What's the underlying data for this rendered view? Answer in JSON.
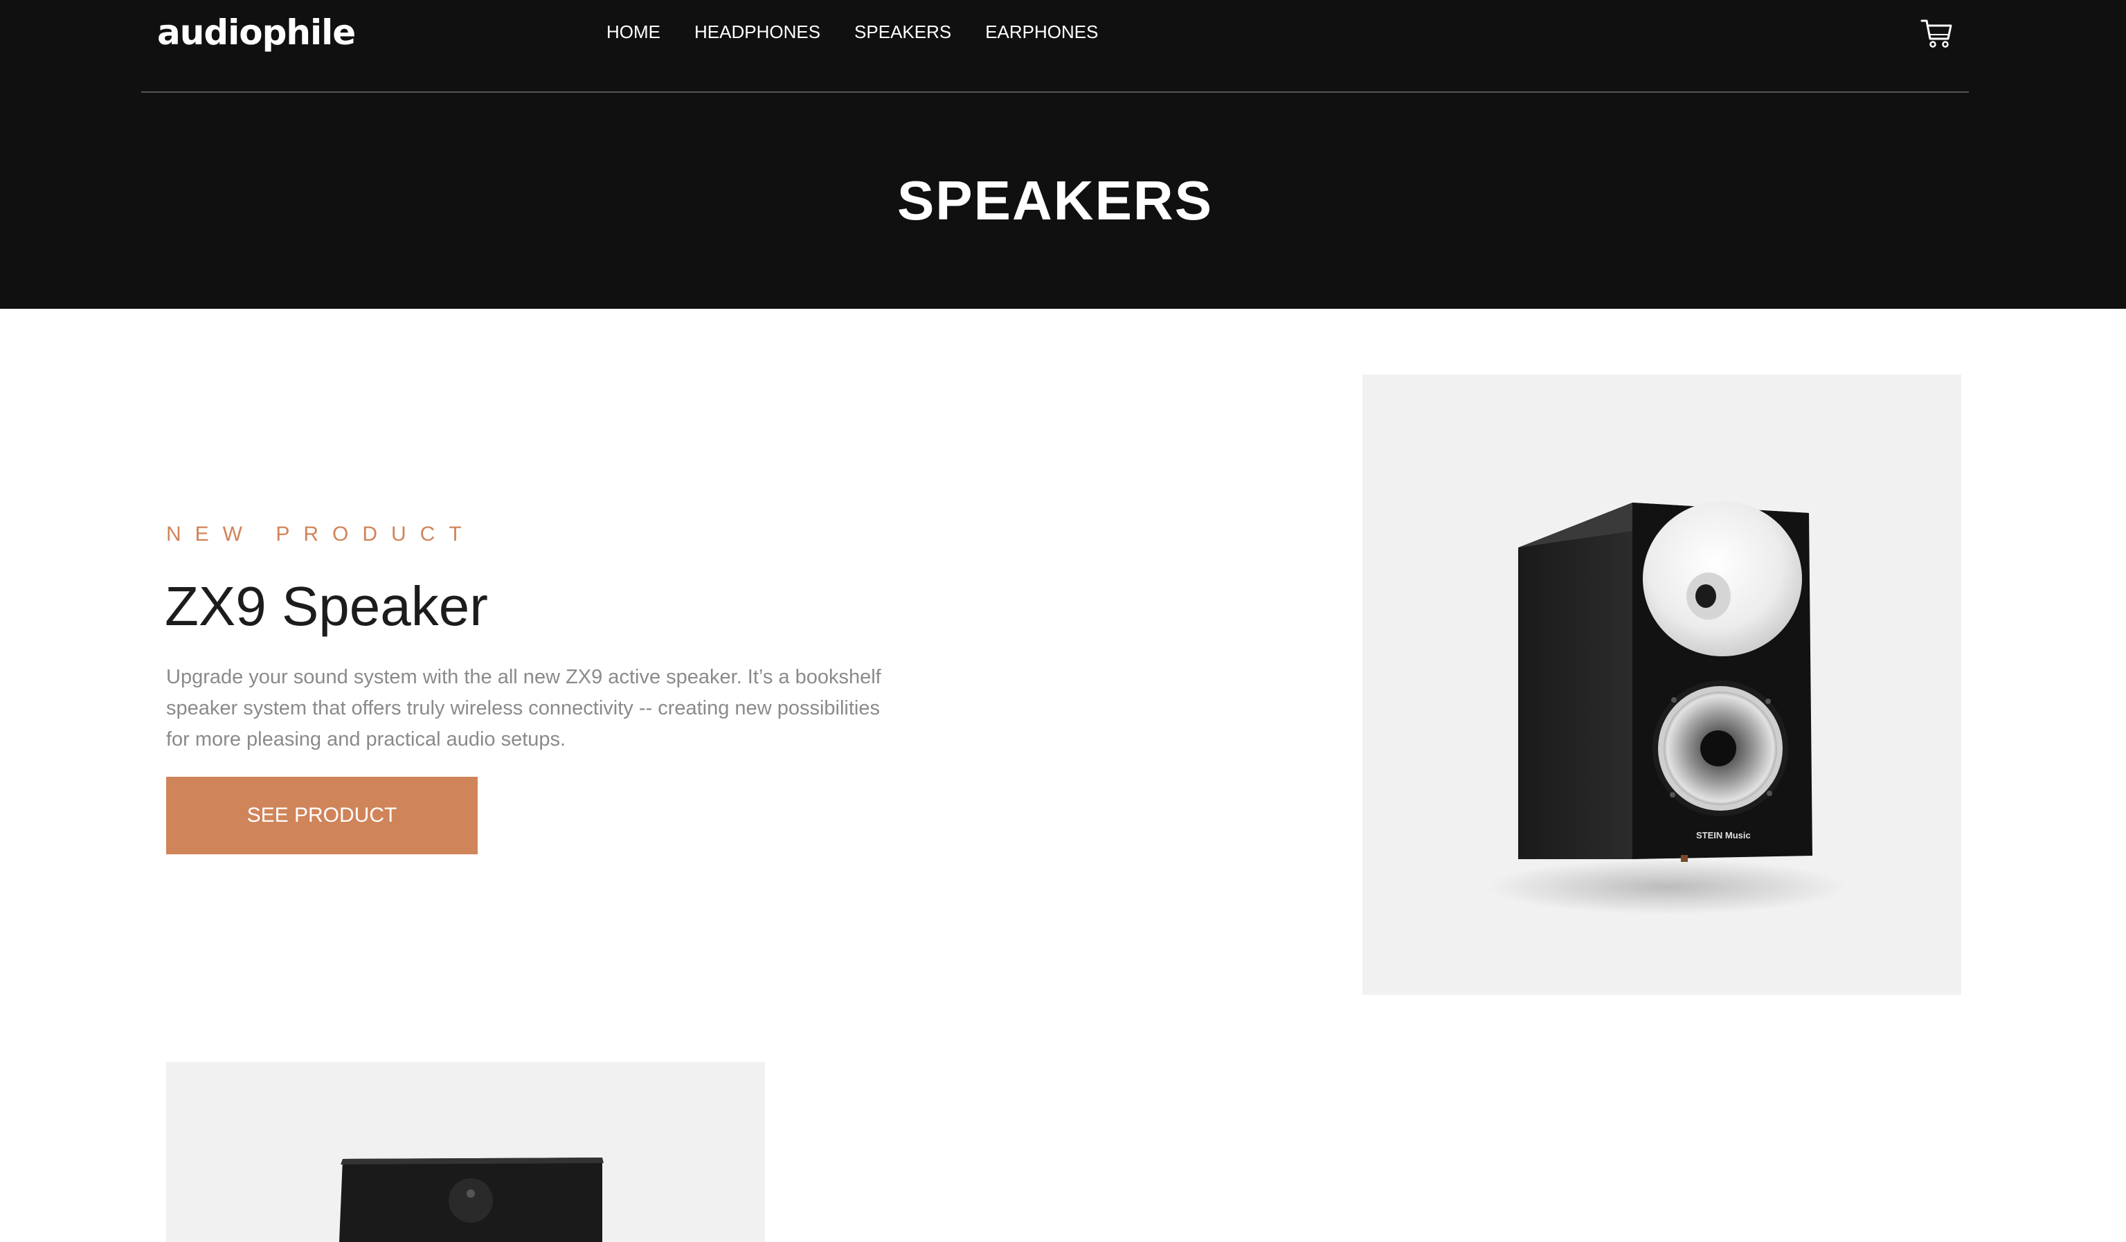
{
  "header": {
    "logo": "audiophile",
    "nav": [
      {
        "label": "HOME"
      },
      {
        "label": "HEADPHONES"
      },
      {
        "label": "SPEAKERS"
      },
      {
        "label": "EARPHONES"
      }
    ],
    "cart_icon": "shopping-cart-icon"
  },
  "hero": {
    "title": "SPEAKERS"
  },
  "product": {
    "eyebrow": "NEW PRODUCT",
    "name": "ZX9 Speaker",
    "description": "Upgrade your sound system with the all new ZX9 active speaker. It’s a bookshelf speaker system that offers truly wireless connectivity -- creating new possibilities for more pleasing and practical audio setups.",
    "cta": "SEE PRODUCT",
    "image_brand": "STEIN Music"
  },
  "colors": {
    "accent": "#D87D4A",
    "dark": "#101010",
    "card": "#F1F1F1"
  }
}
